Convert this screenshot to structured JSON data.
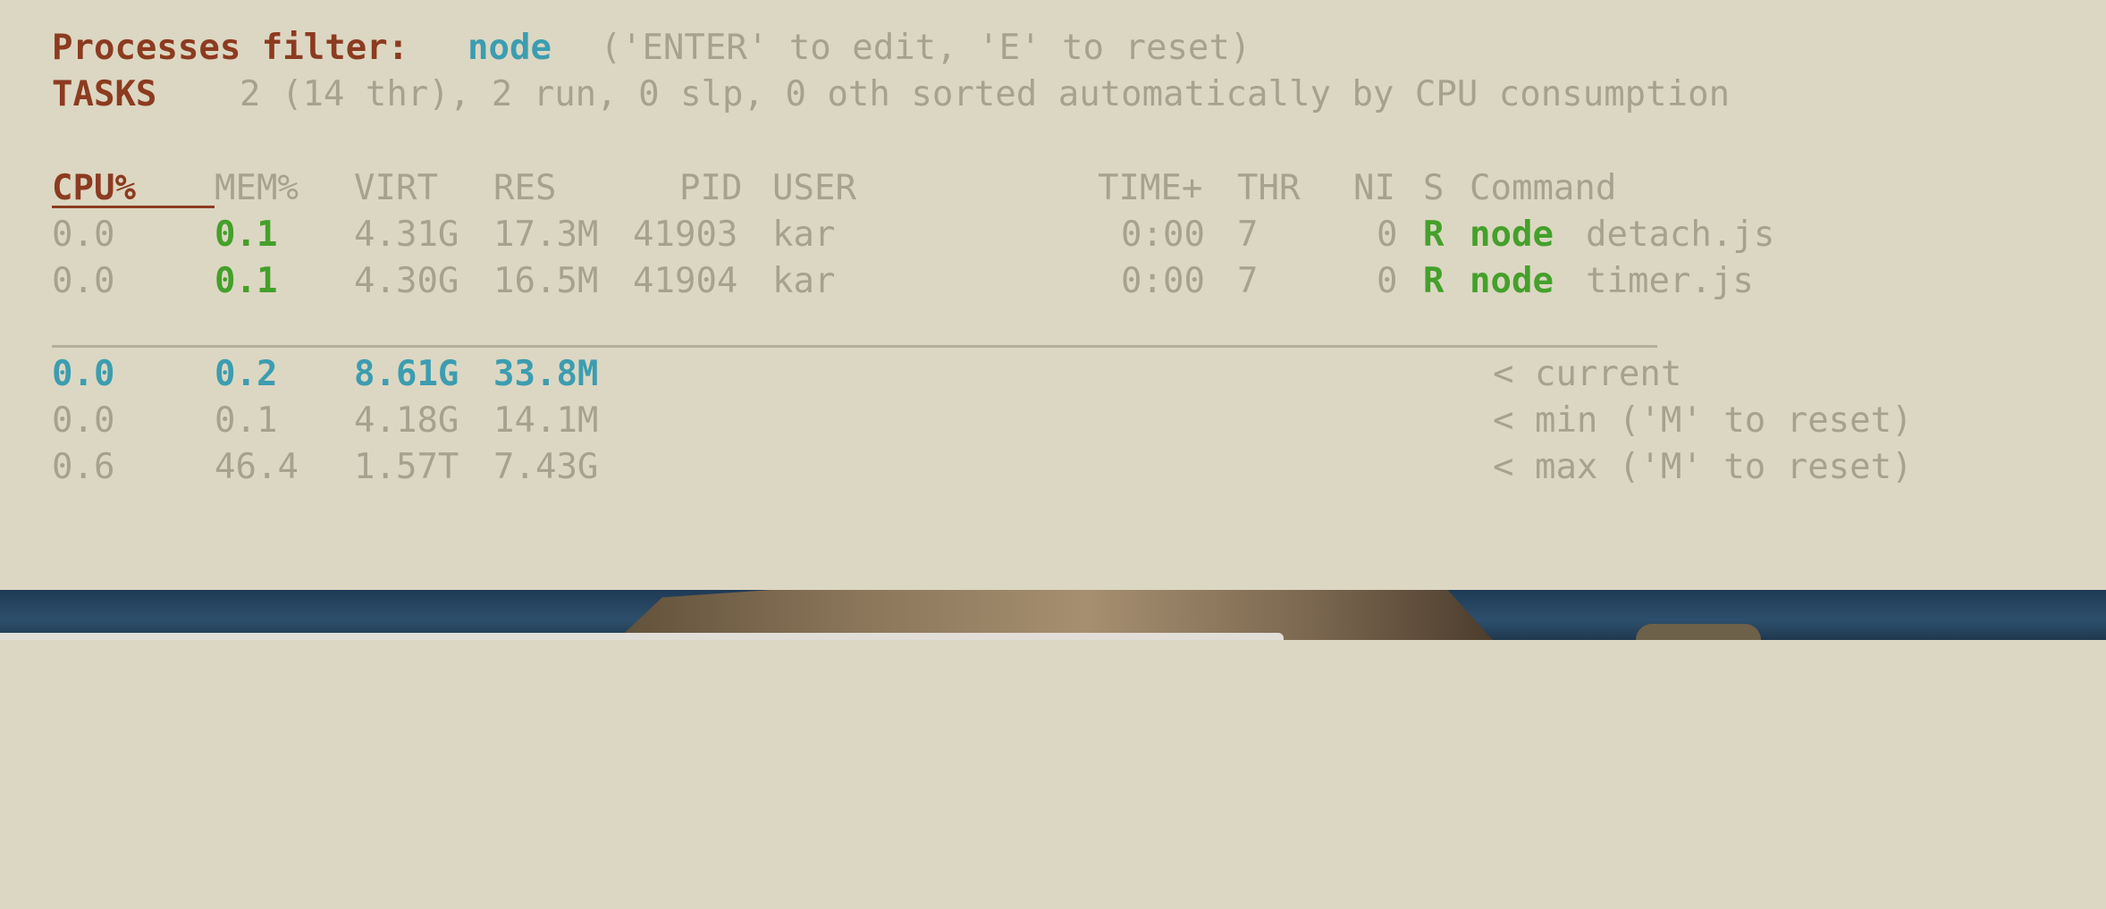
{
  "filter": {
    "label": "Processes filter:",
    "value": "node",
    "hint": " ('ENTER' to edit, 'E' to reset)"
  },
  "tasks": {
    "label": "TASKS",
    "summary": "2 (14 thr), 2 run, 0 slp, 0 oth sorted automatically by CPU consumption"
  },
  "columns": {
    "cpu": "CPU%",
    "mem": "MEM%",
    "virt": "VIRT",
    "res": "RES",
    "pid": "PID",
    "user": "USER",
    "time": "TIME+",
    "thr": "THR",
    "ni": "NI",
    "s": "S",
    "command": "Command"
  },
  "processes": [
    {
      "cpu": "0.0",
      "mem": "0.1",
      "virt": "4.31G",
      "res": "17.3M",
      "pid": "41903",
      "user": "kar",
      "time": "0:00",
      "thr": "7",
      "ni": "0",
      "s": "R",
      "cmd_name": "node",
      "cmd_args": "detach.js"
    },
    {
      "cpu": "0.0",
      "mem": "0.1",
      "virt": "4.30G",
      "res": "16.5M",
      "pid": "41904",
      "user": "kar",
      "time": "0:00",
      "thr": "7",
      "ni": "0",
      "s": "R",
      "cmd_name": "node",
      "cmd_args": "timer.js"
    }
  ],
  "summary": [
    {
      "cpu": "0.0",
      "mem": "0.2",
      "virt": "8.61G",
      "res": "33.8M",
      "label": "< current"
    },
    {
      "cpu": "0.0",
      "mem": "0.1",
      "virt": "4.18G",
      "res": "14.1M",
      "label": "< min ('M' to reset)"
    },
    {
      "cpu": "0.6",
      "mem": "46.4",
      "virt": "1.57T",
      "res": "7.43G",
      "label": "< max ('M' to reset)"
    }
  ],
  "colors": {
    "background": "#dcd7c2",
    "header_brown": "#8c3b20",
    "teal": "#3c9db0",
    "green": "#44a02b",
    "dim": "#a6a28e"
  }
}
